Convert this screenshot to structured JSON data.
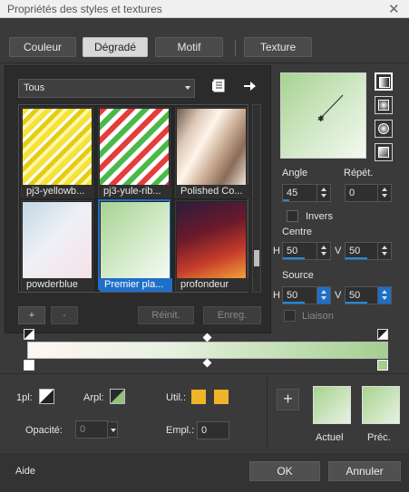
{
  "window": {
    "title": "Propriétés des styles et textures",
    "close": "✕"
  },
  "tabs": [
    "Couleur",
    "Dégradé",
    "Motif",
    "Texture"
  ],
  "left": {
    "category": "Tous",
    "thumbnails": [
      {
        "label": "pj3-yellowb..."
      },
      {
        "label": "pj3-yule-rib..."
      },
      {
        "label": "Polished Co..."
      },
      {
        "label": "powderblue"
      },
      {
        "label": "Premier pla...",
        "selected": true
      },
      {
        "label": "profondeur"
      }
    ],
    "buttons": {
      "add": "+",
      "remove": "-",
      "reset": "Réinit.",
      "save": "Enreg."
    }
  },
  "right": {
    "angle_label": "Angle",
    "angle_value": "45",
    "repeat_label": "Répét.",
    "repeat_value": "0",
    "invert_label": "Invers",
    "center_label": "Centre",
    "center_h": "50",
    "center_v": "50",
    "source_label": "Source",
    "source_h": "50",
    "source_v": "50",
    "h_label": "H",
    "v_label": "V",
    "link_label": "Liaison"
  },
  "bottom": {
    "lpl_label": "1pl:",
    "arpl_label": "Arpl:",
    "util_label": "Util.:",
    "opacity_label": "Opacité:",
    "opacity_value": "0",
    "empl_label": "Empl.:",
    "empl_value": "0",
    "actuel_label": "Actuel",
    "prec_label": "Préc.",
    "plus": "+"
  },
  "footer": {
    "help": "Aide",
    "ok": "OK",
    "cancel": "Annuler"
  },
  "colors": {
    "accent": "#1f6fc8",
    "gradient_start": "#fff6f2",
    "gradient_end": "#a4cf8f",
    "util": "#f0b428"
  }
}
